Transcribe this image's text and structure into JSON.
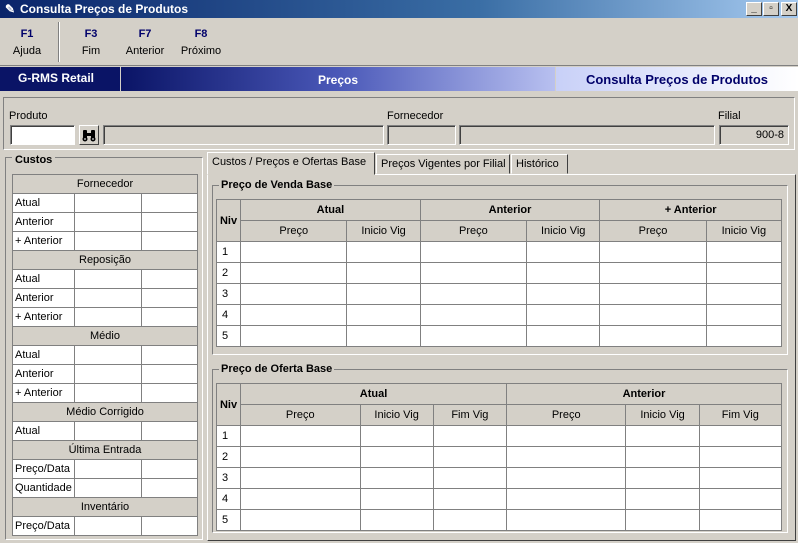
{
  "window": {
    "title": "Consulta Preços de Produtos",
    "min": "_",
    "max": "▫",
    "close": "X"
  },
  "toolbar": [
    {
      "key": "F1",
      "label": "Ajuda"
    },
    {
      "key": "F3",
      "label": "Fim"
    },
    {
      "key": "F7",
      "label": "Anterior"
    },
    {
      "key": "F8",
      "label": "Próximo"
    }
  ],
  "banner": {
    "left": "G-RMS Retail",
    "center": "Preços",
    "right": "Consulta Preços de Produtos"
  },
  "produto": {
    "label": "Produto",
    "code": "",
    "desc": ""
  },
  "fornecedor": {
    "label": "Fornecedor",
    "code": "",
    "desc": ""
  },
  "filial": {
    "label": "Filial",
    "value": "900-8"
  },
  "custos": {
    "title": "Custos",
    "sections": [
      {
        "header": "Fornecedor",
        "rows": [
          "Atual",
          "Anterior",
          "+ Anterior"
        ]
      },
      {
        "header": "Reposição",
        "rows": [
          "Atual",
          "Anterior",
          "+ Anterior"
        ]
      },
      {
        "header": "Médio",
        "rows": [
          "Atual",
          "Anterior",
          "+ Anterior"
        ]
      },
      {
        "header": "Médio Corrigido",
        "rows": [
          "Atual"
        ]
      },
      {
        "header": "Última Entrada",
        "rows": [
          "Preço/Data",
          "Quantidade"
        ]
      },
      {
        "header": "Inventário",
        "rows": [
          "Preço/Data"
        ]
      }
    ]
  },
  "tabs": [
    "Custos / Preços e Ofertas Base",
    "Preços Vigentes por Filial",
    "Histórico"
  ],
  "venda": {
    "title": "Preço de Venda Base",
    "niv": "Niv",
    "groups": [
      "Atual",
      "Anterior",
      "+ Anterior"
    ],
    "cols": [
      "Preço",
      "Inicio Vig",
      "Preço",
      "Inicio Vig",
      "Preço",
      "Inicio Vig"
    ],
    "rows": [
      "1",
      "2",
      "3",
      "4",
      "5"
    ]
  },
  "oferta": {
    "title": "Preço de Oferta Base",
    "niv": "Niv",
    "groups": [
      "Atual",
      "Anterior"
    ],
    "cols": [
      "Preço",
      "Inicio Vig",
      "Fim Vig",
      "Preço",
      "Inicio Vig",
      "Fim Vig"
    ],
    "rows": [
      "1",
      "2",
      "3",
      "4",
      "5"
    ]
  }
}
